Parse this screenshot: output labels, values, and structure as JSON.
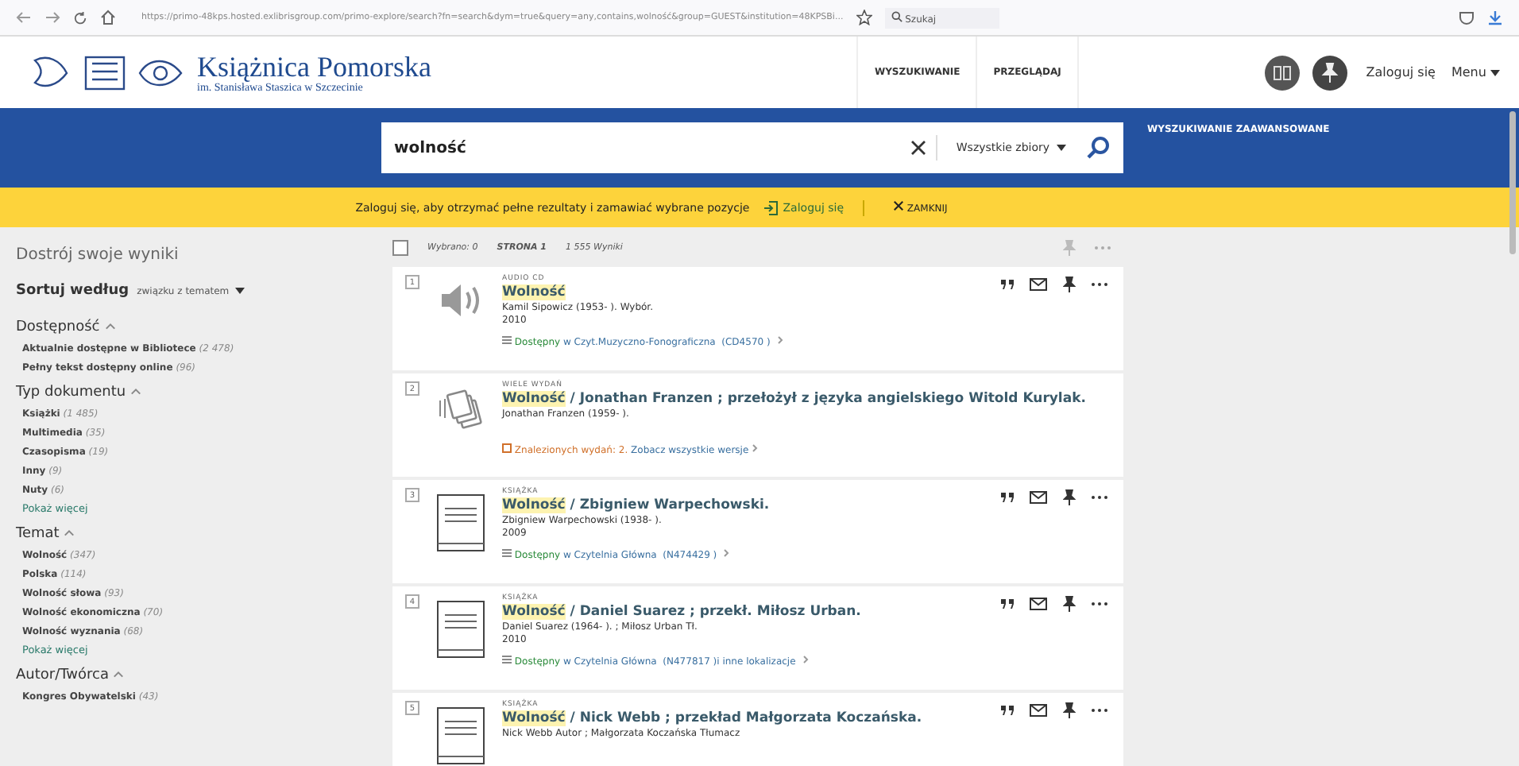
{
  "browser": {
    "url": "https://primo-48kps.hosted.exlibrisgroup.com/primo-explore/search?fn=search&dym=true&query=any,contains,wolność&group=GUEST&institution=48KPSBi...",
    "search_placeholder": "Szukaj"
  },
  "header": {
    "title": "Książnica Pomorska",
    "subtitle": "im. Stanisława Staszica w Szczecinie",
    "nav": [
      "WYSZUKIWANIE",
      "PRZEGLĄDAJ"
    ],
    "login": "Zaloguj się",
    "menu": "Menu"
  },
  "search": {
    "value": "wolność",
    "scope": "Wszystkie zbiory",
    "advanced": "WYSZUKIWANIE ZAAWANSOWANE"
  },
  "banner": {
    "message": "Zaloguj się, aby otrzymać pełne rezultaty i zamawiać wybrane pozycje",
    "login": "Zaloguj się",
    "close": "ZAMKNIJ"
  },
  "sidebar": {
    "title": "Dostrój swoje wyniki",
    "sort_label": "Sortuj według",
    "sort_value": "związku z tematem",
    "facets": [
      {
        "name": "Dostępność",
        "expanded": true,
        "items": [
          {
            "label": "Aktualnie dostępne w Bibliotece",
            "count": "(2 478)"
          },
          {
            "label": "Pełny tekst dostępny online",
            "count": "(96)"
          }
        ]
      },
      {
        "name": "Typ dokumentu",
        "expanded": true,
        "items": [
          {
            "label": "Książki",
            "count": "(1 485)"
          },
          {
            "label": "Multimedia",
            "count": "(35)"
          },
          {
            "label": "Czasopisma",
            "count": "(19)"
          },
          {
            "label": "Inny",
            "count": "(9)"
          },
          {
            "label": "Nuty",
            "count": "(6)"
          }
        ],
        "more": "Pokaż więcej"
      },
      {
        "name": "Temat",
        "expanded": true,
        "items": [
          {
            "label": "Wolność",
            "count": "(347)"
          },
          {
            "label": "Polska",
            "count": "(114)"
          },
          {
            "label": "Wolność słowa",
            "count": "(93)"
          },
          {
            "label": "Wolność ekonomiczna",
            "count": "(70)"
          },
          {
            "label": "Wolność wyznania",
            "count": "(68)"
          }
        ],
        "more": "Pokaż więcej"
      },
      {
        "name": "Autor/Twórca",
        "expanded": true,
        "items": [
          {
            "label": "Kongres Obywatelski",
            "count": "(43)"
          }
        ]
      }
    ]
  },
  "results": {
    "checked": false,
    "selected": "Wybrano: 0",
    "page": "STRONA 1",
    "count": "1 555 Wyniki",
    "records": [
      {
        "number": "1",
        "kind": "audio",
        "type": "AUDIO CD",
        "match": "Wolność",
        "author": "Kamil Sipowicz (1953- ). Wybór.",
        "year": "2010",
        "actions": true,
        "availability": {
          "kind": "available",
          "status": "Dostępny",
          "location": "w Czyt.Muzyczno-Fonograficzna",
          "call_number": "(CD4570 )"
        }
      },
      {
        "number": "2",
        "kind": "versions",
        "type": "WIELE WYDAŃ",
        "match": "Wolność",
        "rest": " / Jonathan Franzen ; przełożył z języka angielskiego Witold Kurylak.",
        "author": "Jonathan Franzen (1959- ).",
        "actions": false,
        "availability": {
          "kind": "versions",
          "status": "Znalezionych wydań: 2.",
          "location": "Zobacz wszystkie wersje"
        }
      },
      {
        "number": "3",
        "kind": "book",
        "type": "KSIĄŻKA",
        "match": "Wolność",
        "rest": " / Zbigniew Warpechowski.",
        "author": "Zbigniew Warpechowski (1938- ).",
        "year": "2009",
        "actions": true,
        "availability": {
          "kind": "available",
          "status": "Dostępny",
          "location": "w Czytelnia Główna",
          "call_number": "(N474429 )"
        }
      },
      {
        "number": "4",
        "kind": "book",
        "type": "KSIĄŻKA",
        "match": "Wolność",
        "rest": " / Daniel Suarez ; przekł. Miłosz Urban.",
        "author": "Daniel Suarez (1964- ). ; Miłosz Urban Tł.",
        "year": "2010",
        "actions": true,
        "availability": {
          "kind": "available",
          "status": "Dostępny",
          "location": "w Czytelnia Główna",
          "call_number": "(N477817 )",
          "extra": "i inne lokalizacje"
        }
      },
      {
        "number": "5",
        "kind": "book",
        "type": "KSIĄŻKA",
        "match": "Wolność",
        "rest": " / Nick Webb ; przekład Małgorzata Koczańska.",
        "author": "Nick Webb Autor ; Małgorzata Koczańska Tłumacz",
        "actions": true
      }
    ]
  }
}
